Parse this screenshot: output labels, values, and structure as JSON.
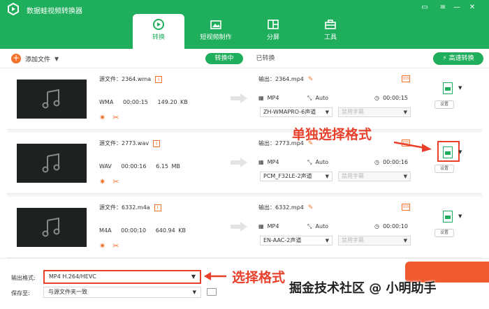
{
  "app": {
    "title": "数据蛙视频转换器"
  },
  "window": {
    "icons": [
      "menu-icon",
      "settings-icon",
      "minimize-icon",
      "close-icon"
    ]
  },
  "tabs": [
    {
      "label": "转换",
      "icon": "convert-icon",
      "active": true
    },
    {
      "label": "短视频制作",
      "icon": "video-maker-icon",
      "active": false
    },
    {
      "label": "分屏",
      "icon": "split-screen-icon",
      "active": false
    },
    {
      "label": "工具",
      "icon": "toolbox-icon",
      "active": false
    }
  ],
  "toolbar": {
    "add_label": "添加文件",
    "converting": "转换中",
    "converted": "已转换",
    "fast_convert": "高速转换"
  },
  "files": [
    {
      "src_label": "源文件：",
      "src_name": "2364.wma",
      "format": "WMA",
      "duration": "00:00:15",
      "size": "149.20 KB",
      "out_label": "输出：",
      "out_name": "2364.mp4",
      "out_format": "MP4",
      "resolution": "Auto",
      "out_duration": "00:00:15",
      "audio": "ZH-WMAPRO-6声道",
      "subtitle": "禁用字幕",
      "settings": "设置"
    },
    {
      "src_label": "源文件：",
      "src_name": "2773.wav",
      "format": "WAV",
      "duration": "00:00:16",
      "size": "6.15 MB",
      "out_label": "输出：",
      "out_name": "2773.mp4",
      "out_format": "MP4",
      "resolution": "Auto",
      "out_duration": "00:00:16",
      "audio": "PCM_F32LE-2声道",
      "subtitle": "禁用字幕",
      "settings": "设置"
    },
    {
      "src_label": "源文件：",
      "src_name": "6332.m4a",
      "format": "M4A",
      "duration": "00:00:10",
      "size": "640.94 KB",
      "out_label": "输出：",
      "out_name": "6332.mp4",
      "out_format": "MP4",
      "resolution": "Auto",
      "out_duration": "00:00:10",
      "audio": "EN-AAC-2声道",
      "subtitle": "禁用字幕",
      "settings": "设置"
    }
  ],
  "annotations": {
    "single_format": "单独选择格式",
    "select_format": "选择格式"
  },
  "bottom": {
    "output_label": "输出格式:",
    "output_value": "MP4 H.264/HEVC",
    "save_label": "保存至:",
    "save_value": "与源文件夹一致"
  },
  "watermark": "掘金技术社区 @ 小明助手",
  "colors": {
    "brand": "#1fae5c",
    "accent": "#f4722b",
    "annotation": "#e8402a"
  }
}
